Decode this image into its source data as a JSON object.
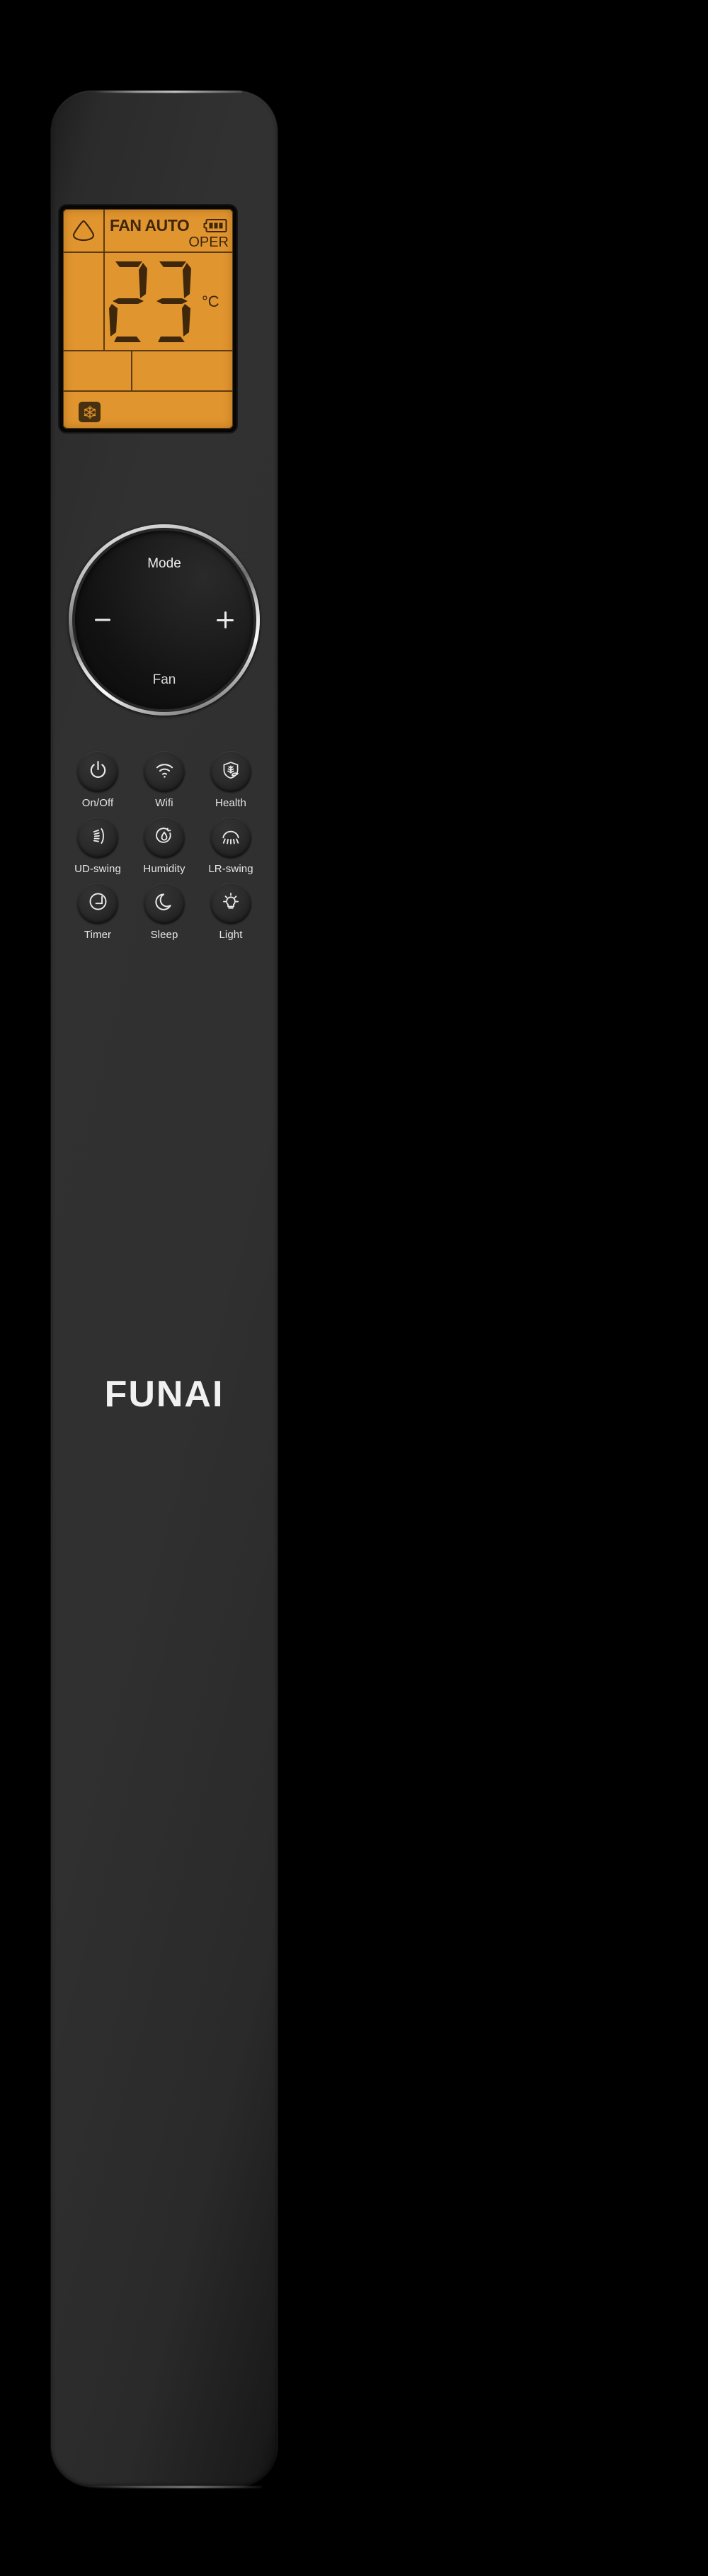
{
  "device": {
    "brand": "FUNAI",
    "type": "air-conditioner-remote"
  },
  "display": {
    "fan_status": "FAN AUTO",
    "operation_indicator": "OPER",
    "battery_bars": 3,
    "temperature": "23",
    "temperature_unit": "°C",
    "mode_icon": "snowflake-icon",
    "fan_mark_icon": "rounded-triangle-icon",
    "backlight_color": "#e1952f",
    "segment_color": "#3f270b"
  },
  "dial": {
    "top_label": "Mode",
    "bottom_label": "Fan",
    "left_control": "−",
    "right_control": "+"
  },
  "buttons": [
    [
      {
        "label": "On/Off",
        "icon": "power-icon"
      },
      {
        "label": "Wifi",
        "icon": "wifi-icon"
      },
      {
        "label": "Health",
        "icon": "shield-leaf-icon"
      }
    ],
    [
      {
        "label": "UD-swing",
        "icon": "updown-swing-icon"
      },
      {
        "label": "Humidity",
        "icon": "water-drop-cycle-icon"
      },
      {
        "label": "LR-swing",
        "icon": "leftright-swing-icon"
      }
    ],
    [
      {
        "label": "Timer",
        "icon": "clock-icon"
      },
      {
        "label": "Sleep",
        "icon": "moon-icon"
      },
      {
        "label": "Light",
        "icon": "lightbulb-icon"
      }
    ]
  ],
  "colors": {
    "body": "#2e2e2e",
    "lcd": "#e1952f",
    "accent_text": "#ececec",
    "background": "#000000"
  }
}
